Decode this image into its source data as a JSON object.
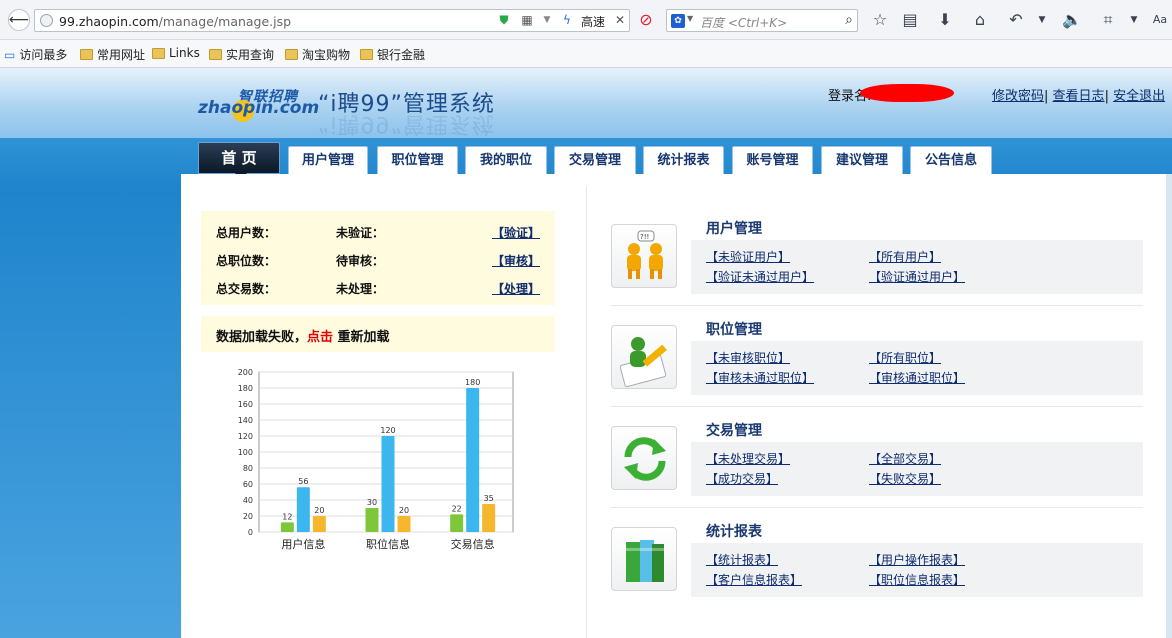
{
  "browser": {
    "url_host": "99.zhaopin.com",
    "url_path": "/manage/manage.jsp",
    "speed_label": "高速",
    "search_placeholder": "百度 <Ctrl+K>",
    "bookmarks": [
      "访问最多",
      "常用网址",
      "Links",
      "实用查询",
      "淘宝购物",
      "银行金融"
    ]
  },
  "header": {
    "logo_cn": "智联招聘",
    "logo_en": "zhaopin.com",
    "system_title": "“i聘99”管理系统",
    "login_label": "登录名:",
    "links": [
      "修改密码",
      "查看日志",
      "安全退出"
    ]
  },
  "nav": {
    "tabs": [
      "首 页",
      "用户管理",
      "职位管理",
      "我的职位",
      "交易管理",
      "统计报表",
      "账号管理",
      "建议管理",
      "公告信息"
    ]
  },
  "stats": {
    "rows": [
      {
        "label": "总用户数：",
        "sub": "未验证：",
        "link": "【验证】"
      },
      {
        "label": "总职位数：",
        "sub": "待审核：",
        "link": "【审核】"
      },
      {
        "label": "总交易数：",
        "sub": "未处理：",
        "link": "【处理】"
      }
    ],
    "load_fail_pre": "数据加载失败，",
    "load_fail_click": "点击",
    "load_fail_post": " 重新加载"
  },
  "chart_data": {
    "type": "bar",
    "categories": [
      "用户信息",
      "职位信息",
      "交易信息"
    ],
    "series": [
      {
        "values": [
          12,
          30,
          22
        ],
        "color": "#7ec63a"
      },
      {
        "values": [
          56,
          120,
          180
        ],
        "color": "#3bb6ee"
      },
      {
        "values": [
          20,
          20,
          35
        ],
        "color": "#f5b72e"
      }
    ],
    "yticks": [
      0,
      20,
      40,
      60,
      80,
      100,
      120,
      140,
      160,
      180,
      200
    ],
    "ylim": [
      0,
      200
    ],
    "grid": true
  },
  "sections": [
    {
      "title": "用户管理",
      "icon": "users-icon",
      "links": [
        "【未验证用户】",
        "【所有用户】",
        "【验证未通过用户】",
        "【验证通过用户】"
      ]
    },
    {
      "title": "职位管理",
      "icon": "job-edit-icon",
      "links": [
        "【未审核职位】",
        "【所有职位】",
        "【审核未通过职位】",
        "【审核通过职位】"
      ]
    },
    {
      "title": "交易管理",
      "icon": "refresh-icon",
      "links": [
        "【未处理交易】",
        "【全部交易】",
        "【成功交易】",
        "【失败交易】"
      ]
    },
    {
      "title": "统计报表",
      "icon": "books-icon",
      "links": [
        "【统计报表】",
        "【用户操作报表】",
        "【客户信息报表】",
        "【职位信息报表】"
      ]
    }
  ]
}
